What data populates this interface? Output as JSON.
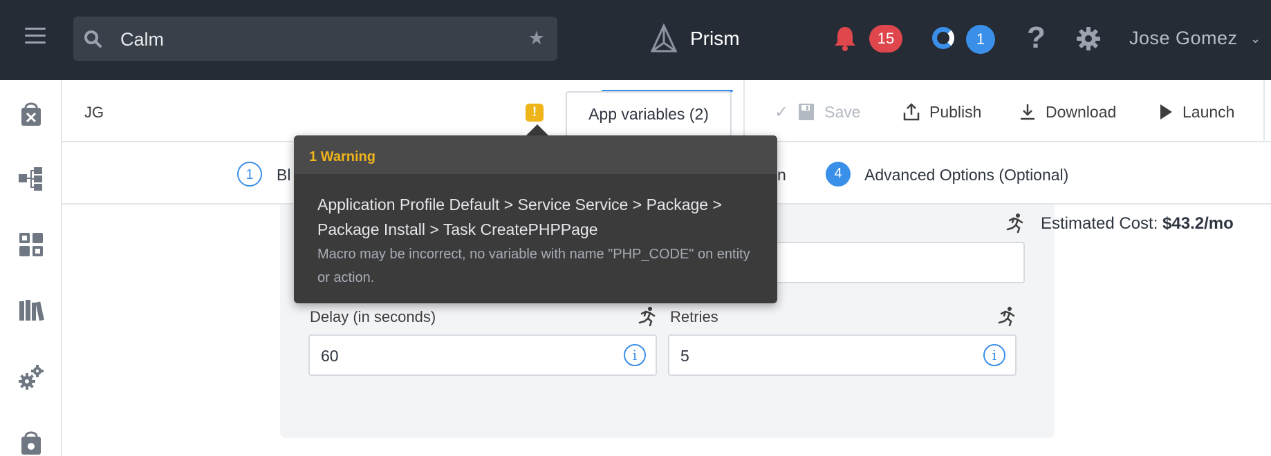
{
  "topbar": {
    "search_value": "Calm",
    "brand": "Prism",
    "alerts_count": "15",
    "tasks_count": "1",
    "user_name": "Jose Gomez"
  },
  "toolbar": {
    "blueprint_name": "JG",
    "app_variables_label": "App variables (2)",
    "save_label": "Save",
    "publish_label": "Publish",
    "download_label": "Download",
    "launch_label": "Launch"
  },
  "steps": [
    {
      "number": "1",
      "label": "Bl"
    },
    {
      "number": "",
      "label": "n"
    },
    {
      "number": "4",
      "label": "Advanced Options (Optional)"
    }
  ],
  "cost": {
    "label": "Estimated Cost:",
    "value": "$43.2/mo"
  },
  "form": {
    "delay_label": "Delay (in seconds)",
    "delay_value": "60",
    "retries_label": "Retries",
    "retries_value": "5"
  },
  "popover": {
    "title": "1 Warning",
    "path": "Application Profile Default > Service Service > Package > Package Install > Task CreatePHPPage",
    "message": "Macro may be incorrect, no variable with name \"PHP_CODE\" on entity or action."
  },
  "colors": {
    "topbar_bg": "#262c36",
    "accent_blue": "#3a8fe8",
    "alert_red": "#e0474d",
    "warning_yellow": "#f0b41b"
  }
}
